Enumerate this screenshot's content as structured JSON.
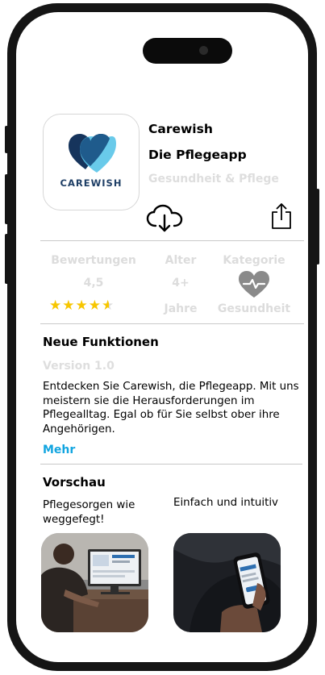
{
  "app": {
    "icon_brand_text": "CAREWISH",
    "name": "Carewish",
    "subtitle": "Die Pflegeapp",
    "category_line": "Gesundheit & Pflege"
  },
  "stats": {
    "ratings": {
      "label": "Bewertungen",
      "value": "4,5",
      "stars": 4.5
    },
    "age": {
      "label": "Alter",
      "value": "4+",
      "unit": "Jahre"
    },
    "category": {
      "label": "Kategorie",
      "value": "Gesundheit"
    }
  },
  "whats_new": {
    "title": "Neue Funktionen",
    "version": "Version 1.0",
    "description": "Entdecken Sie Carewish, die Pflegeapp. Mit uns meistern sie die Herausforderungen im Pflegealltag. Egal ob für Sie selbst ober ihre Angehörigen.",
    "more_label": "Mehr"
  },
  "preview": {
    "title": "Vorschau",
    "items": [
      {
        "caption": "Pflegesorgen wie weggefegt!"
      },
      {
        "caption": "Einfach und intuitiv"
      }
    ]
  },
  "colors": {
    "accent_blue": "#12a5e0",
    "star_yellow": "#f7c600",
    "muted_text": "#dcdcdc",
    "heart_dark": "#16345c",
    "heart_light": "#5cc6e8"
  },
  "icons": {
    "download": "cloud-download-icon",
    "share": "share-icon",
    "category": "heart-pulse-icon"
  }
}
